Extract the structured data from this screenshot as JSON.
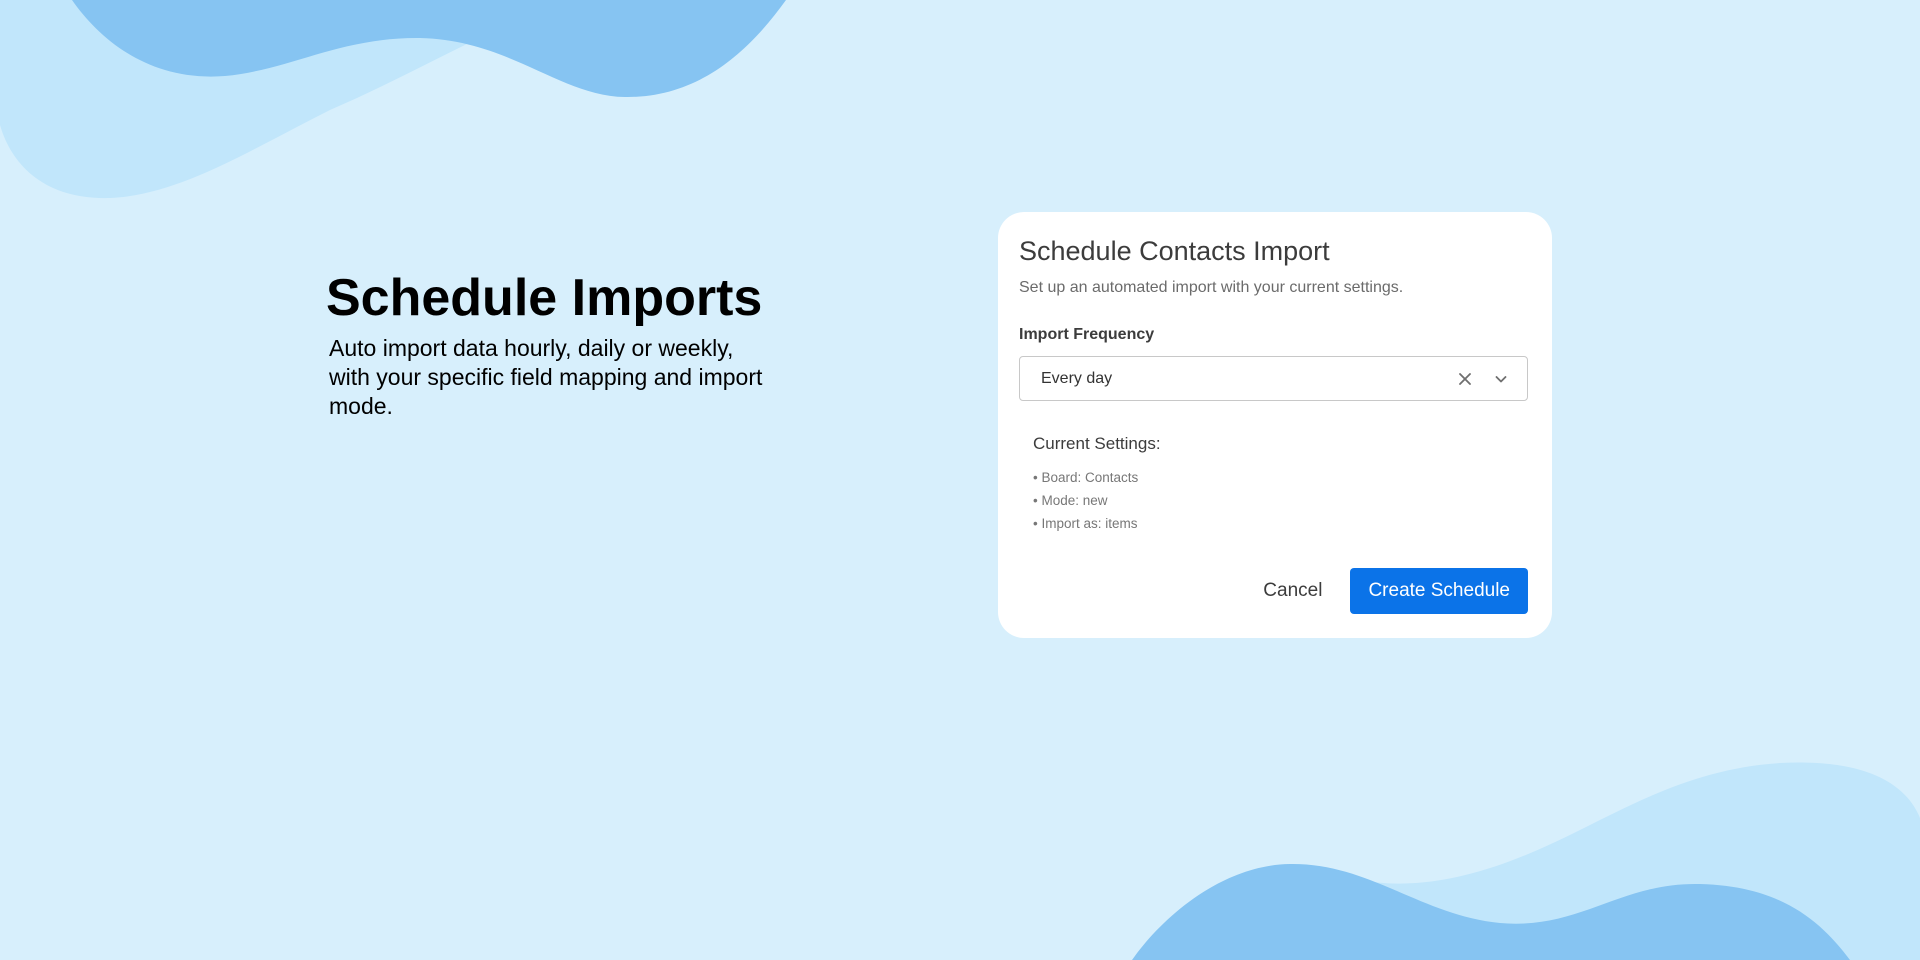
{
  "hero": {
    "title": "Schedule Imports",
    "subtitle": "Auto import data hourly, daily or weekly, with your specific field mapping and import mode."
  },
  "dialog": {
    "title": "Schedule Contacts Import",
    "description": "Set up an automated import with your current settings.",
    "frequency_label": "Import Frequency",
    "frequency_value": "Every day",
    "clear_icon": "close-icon",
    "dropdown_icon": "chevron-down-icon",
    "settings_title": "Current Settings:",
    "settings": [
      "• Board: Contacts",
      "• Mode: new",
      "• Import as: items"
    ],
    "cancel_label": "Cancel",
    "submit_label": "Create Schedule"
  },
  "colors": {
    "background": "#d7effc",
    "wave_light": "#c1e6fb",
    "wave_dark": "#86c4f2",
    "primary": "#0b73e8"
  }
}
